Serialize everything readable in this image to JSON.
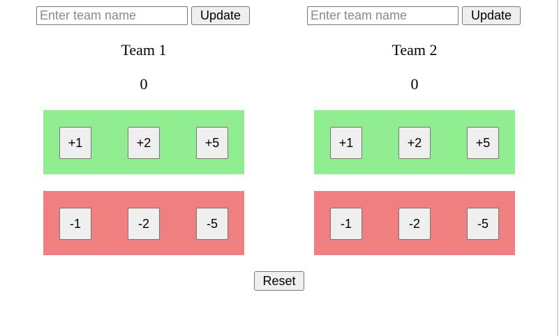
{
  "teams": [
    {
      "name_input": {
        "placeholder": "Enter team name",
        "value": ""
      },
      "update_label": "Update",
      "name": "Team 1",
      "score": "0",
      "increment_labels": [
        "+1",
        "+2",
        "+5"
      ],
      "decrement_labels": [
        "-1",
        "-2",
        "-5"
      ]
    },
    {
      "name_input": {
        "placeholder": "Enter team name",
        "value": ""
      },
      "update_label": "Update",
      "name": "Team 2",
      "score": "0",
      "increment_labels": [
        "+1",
        "+2",
        "+5"
      ],
      "decrement_labels": [
        "-1",
        "-2",
        "-5"
      ]
    }
  ],
  "reset_label": "Reset",
  "colors": {
    "increment_panel": "#90ee90",
    "decrement_panel": "#f08080",
    "button_bg": "#efefef"
  }
}
